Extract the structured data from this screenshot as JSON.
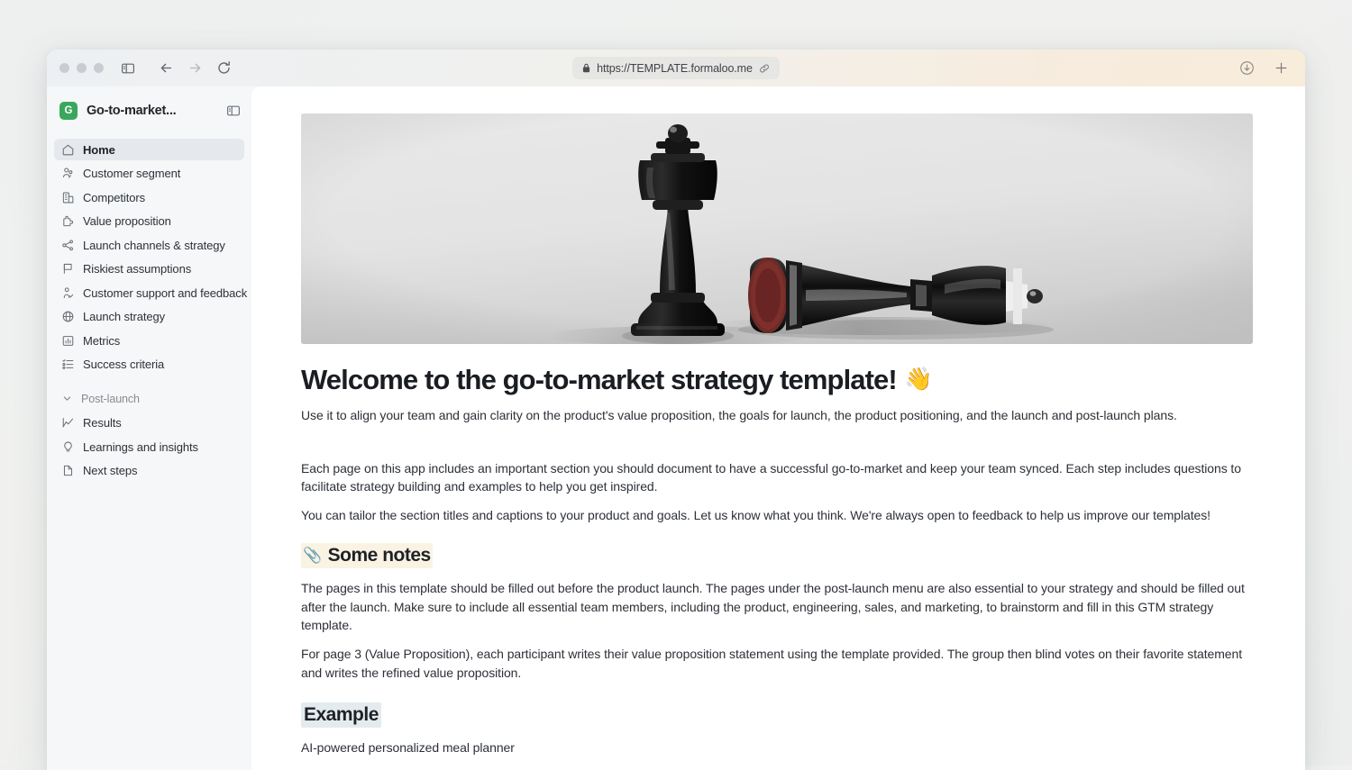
{
  "browser": {
    "url": "https://TEMPLATE.formaloo.me",
    "lock_icon": "lock-icon",
    "link_icon": "link-icon",
    "back_icon": "back-arrow-icon",
    "forward_icon": "forward-arrow-icon",
    "reload_icon": "reload-icon",
    "sidebar_toggle_icon": "sidebar-toggle-icon",
    "download_icon": "download-icon",
    "new_tab_icon": "plus-icon"
  },
  "sidebar": {
    "workspace": {
      "badge_letter": "G",
      "title": "Go-to-market...",
      "badge_color": "#3ba75c",
      "toggle_icon": "panel-toggle-icon"
    },
    "items": [
      {
        "label": "Home",
        "icon": "home-icon",
        "active": true
      },
      {
        "label": "Customer segment",
        "icon": "users-icon",
        "active": false
      },
      {
        "label": "Competitors",
        "icon": "building-icon",
        "active": false
      },
      {
        "label": "Value proposition",
        "icon": "puzzle-icon",
        "active": false
      },
      {
        "label": "Launch channels & strategy",
        "icon": "share-icon",
        "active": false
      },
      {
        "label": "Riskiest assumptions",
        "icon": "flag-icon",
        "active": false
      },
      {
        "label": "Customer support and feedback",
        "icon": "user-check-icon",
        "active": false
      },
      {
        "label": "Launch strategy",
        "icon": "globe-icon",
        "active": false
      },
      {
        "label": "Metrics",
        "icon": "bar-chart-icon",
        "active": false
      },
      {
        "label": "Success criteria",
        "icon": "checklist-icon",
        "active": false
      }
    ],
    "section": {
      "label": "Post-launch",
      "chevron_icon": "chevron-down-icon",
      "items": [
        {
          "label": "Results",
          "icon": "line-chart-icon"
        },
        {
          "label": "Learnings and insights",
          "icon": "lightbulb-icon"
        },
        {
          "label": "Next steps",
          "icon": "file-icon"
        }
      ]
    }
  },
  "content": {
    "hero_alt": "black chess king standing next to a fallen chess king",
    "title": "Welcome to the go-to-market strategy template!",
    "title_emoji": "👋",
    "lede": "Use it to align your team and gain clarity on the product's value proposition, the goals for launch, the product positioning, and the launch and post-launch plans.",
    "paragraph_1": "Each page on this app includes an important section you should document to have a successful go-to-market and keep your team synced. Each step includes questions to facilitate strategy building and examples to help you get inspired.",
    "paragraph_2": "You can tailor the section titles and captions to your product and goals. Let us know what you think. We're always open to feedback to help us improve our templates!",
    "notes_emoji": "📎",
    "notes_heading": "Some notes",
    "notes_paragraph_1": "The pages in this template should be filled out before the product launch. The pages under the post-launch menu are also essential to your strategy and should be filled out after the launch. Make sure to include all essential team members, including the product, engineering, sales, and marketing, to brainstorm and fill in this GTM strategy template.",
    "notes_paragraph_2": "For page 3 (Value Proposition), each participant writes their value proposition statement using the template provided. The group then blind votes on their favorite statement and writes the refined value proposition.",
    "example_heading": "Example",
    "example_body": "AI-powered personalized meal planner"
  }
}
